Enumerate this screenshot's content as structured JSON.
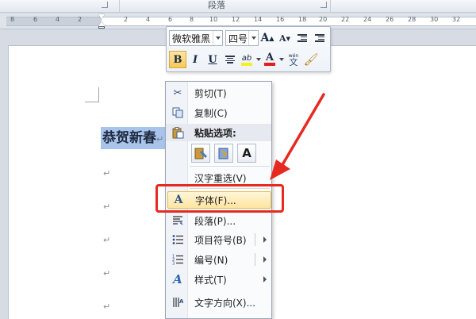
{
  "ribbon": {
    "group_label": "段落"
  },
  "ruler": {
    "numbers": [
      "8",
      "6",
      "4",
      "2",
      "",
      "2",
      "4",
      "6",
      "8",
      "10",
      "12",
      "14",
      "16",
      "18",
      "20",
      "22",
      "24",
      "26",
      "28",
      "30",
      "32"
    ]
  },
  "document": {
    "selected_text": "恭贺新春",
    "paragraph_mark": "↵"
  },
  "mini_toolbar": {
    "font_name": "微软雅黑",
    "font_size": "四号",
    "grow_font": "A",
    "shrink_font": "A",
    "bold": "B",
    "italic": "I",
    "underline": "U",
    "font_color_letter": "A",
    "phonetic_top": "wén",
    "phonetic_char": "文",
    "highlight_label": "ab"
  },
  "context_menu": {
    "items": [
      {
        "label": "剪切(T)",
        "icon": "scissors-icon"
      },
      {
        "label": "复制(C)",
        "icon": "copy-icon"
      },
      {
        "label": "粘贴选项:",
        "icon": "paste-icon"
      },
      {
        "label": "汉字重选(V)",
        "icon": ""
      },
      {
        "label": "字体(F)...",
        "icon": "font-icon",
        "glyph": "A"
      },
      {
        "label": "段落(P)...",
        "icon": "paragraph-icon"
      },
      {
        "label": "项目符号(B)",
        "icon": "bullets-icon"
      },
      {
        "label": "编号(N)",
        "icon": "numbering-icon"
      },
      {
        "label": "样式(T)",
        "icon": "styles-icon",
        "glyph": "A"
      },
      {
        "label": "文字方向(X)...",
        "icon": "text-direction-icon"
      }
    ],
    "paste_keep_text_glyph": "A"
  },
  "colors": {
    "highlight": "#a9c4ea",
    "annotation": "#e62a22",
    "menu_hover": "#fde4a0"
  }
}
